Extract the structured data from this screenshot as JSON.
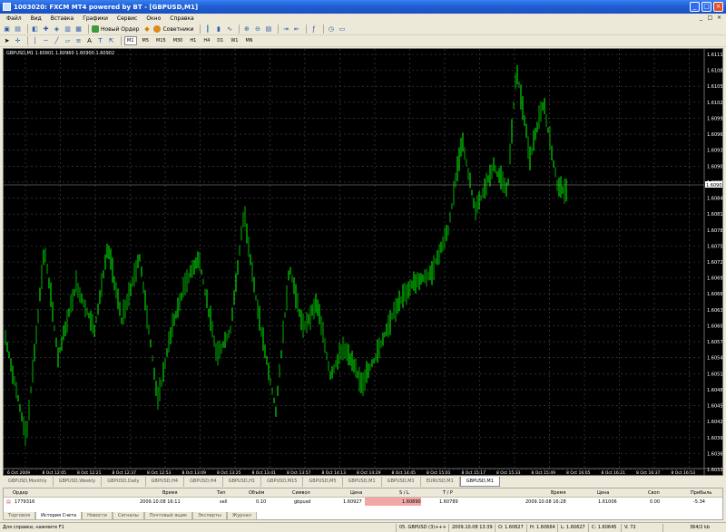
{
  "window": {
    "title": "1003020: FXCM MT4 powered by BT - [GBPUSD,M1]",
    "controls": [
      "_",
      "□",
      "×"
    ]
  },
  "menu": [
    "Файл",
    "Вид",
    "Вставка",
    "Графики",
    "Сервис",
    "Окно",
    "Справка"
  ],
  "toolbar": {
    "new_order": "Новый Ордер",
    "experts": "Советники",
    "timeframes": [
      "M1",
      "M5",
      "M15",
      "M30",
      "H1",
      "H4",
      "D1",
      "W1",
      "MN"
    ],
    "active_timeframe": "M1"
  },
  "chart": {
    "label": "GBPUSD,M1  1.60901 1.60960 1.60900 1.60902",
    "current_price": "1.60902",
    "price_labels": [
      "1.61115",
      "1.61085",
      "1.61055",
      "1.61025",
      "1.60995",
      "1.60965",
      "1.60935",
      "1.60905",
      "1.60875",
      "1.60845",
      "1.60815",
      "1.60785",
      "1.60755",
      "1.60725",
      "1.60695",
      "1.60665",
      "1.60635",
      "1.60605",
      "1.60575",
      "1.60545",
      "1.60515",
      "1.60485",
      "1.60455",
      "1.60425",
      "1.60395",
      "1.60365",
      "1.60335"
    ],
    "time_labels": [
      "6 Oct 2009",
      "8 Oct 12:05",
      "8 Oct 12:21",
      "8 Oct 12:37",
      "8 Oct 12:53",
      "8 Oct 13:09",
      "8 Oct 13:25",
      "8 Oct 13:41",
      "8 Oct 13:57",
      "8 Oct 14:13",
      "8 Oct 14:29",
      "8 Oct 14:45",
      "8 Oct 15:01",
      "8 Oct 15:17",
      "8 Oct 15:33",
      "8 Oct 15:49",
      "8 Oct 16:05",
      "8 Oct 16:21",
      "8 Oct 16:37",
      "8 Oct 16:53"
    ],
    "bull_color": "#00ff00",
    "bear_color": "#00b000",
    "grid_color": "#4a4a4a"
  },
  "chart_tabs": [
    "GBPUSD,Monthly",
    "GBPUSD,Weekly",
    "GBPUSD,Daily",
    "GBPUSD,H4",
    "GBPUSD,H4",
    "GBPUSD,H1",
    "GBPUSD,M15",
    "GBPUSD,M5",
    "GBPUSD,M1",
    "GBPUSD,M1",
    "EURUSD,M1",
    "GBPUSD,M1"
  ],
  "active_chart_tab": 11,
  "terminal": {
    "headers": [
      "Ордер",
      "Время",
      "Тип",
      "Объём",
      "Символ",
      "Цена",
      "S / L",
      "T / P",
      "Время",
      "Цена",
      "Своп",
      "Прибыль"
    ],
    "row": [
      "1779316",
      "2009.10.08 16:11",
      "sell",
      "0.10",
      "gbpusd",
      "1.60927",
      "1.60890",
      "1.60789",
      "2009.10.08 16:28",
      "1.61006",
      "0.00",
      "-5.34"
    ],
    "tabs": [
      "Торговля",
      "История Счета",
      "Новости",
      "Сигналы",
      "Почтовый ящик",
      "Эксперты",
      "Журнал"
    ],
    "active_tab": 1,
    "sl_highlight": "#f4a6a6"
  },
  "status": {
    "help": "Для справки, нажмите F1",
    "bar_info": "05. GBPUSD (3)+++",
    "time": "2009.10.08 13:39",
    "open": "O: 1.60627",
    "high": "H: 1.60664",
    "low": "L: 1.60627",
    "close": "C: 1.60645",
    "volume": "V: 72",
    "traffic": "364/2 kb"
  }
}
